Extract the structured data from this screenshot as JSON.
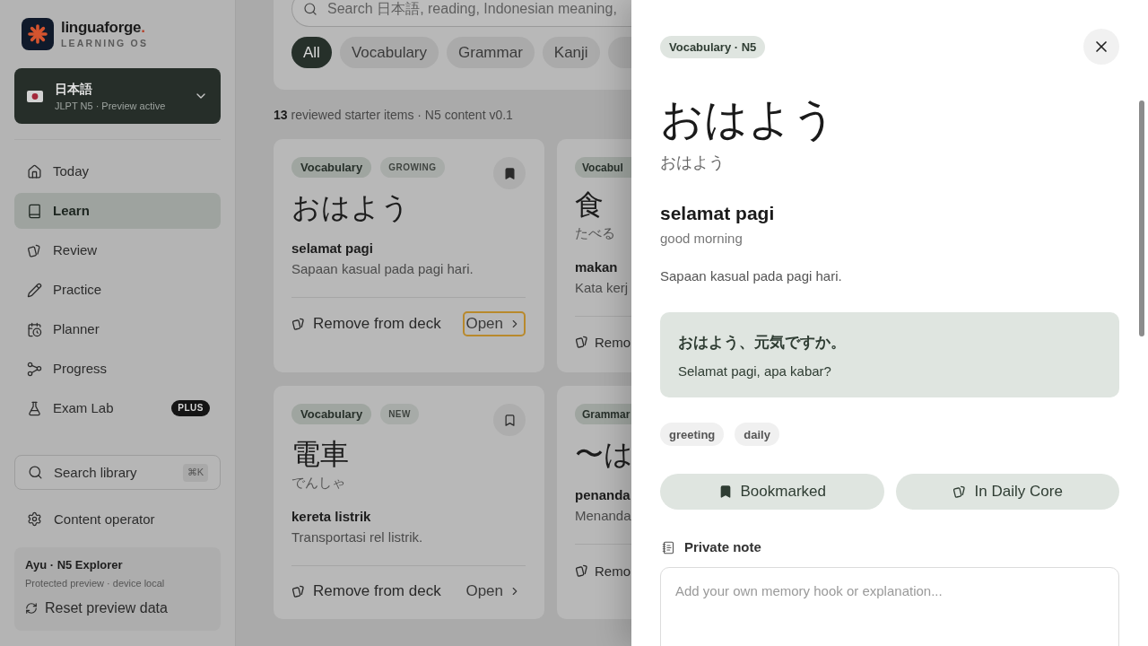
{
  "sidebar": {
    "brand": {
      "name": "linguaforge.",
      "tagline": "LEARNING OS"
    },
    "language": {
      "name": "日本語",
      "detail": "JLPT N5 · Preview active"
    },
    "nav": [
      {
        "label": "Today",
        "selected": false
      },
      {
        "label": "Learn",
        "selected": true
      },
      {
        "label": "Review",
        "selected": false
      },
      {
        "label": "Practice",
        "selected": false
      },
      {
        "label": "Planner",
        "selected": false
      },
      {
        "label": "Progress",
        "selected": false
      },
      {
        "label": "Exam Lab",
        "selected": false,
        "badge": "PLUS"
      }
    ],
    "search": {
      "label": "Search library",
      "shortcut": "⌘K"
    },
    "operator": {
      "label": "Content operator"
    },
    "profile": {
      "name": "Ayu · N5 Explorer",
      "detail": "Protected preview · device local",
      "action": "Reset preview data"
    }
  },
  "library": {
    "search": {
      "placeholder": "Search 日本語, reading, Indonesian meaning,"
    },
    "filters": [
      {
        "label": "All",
        "selected": true
      },
      {
        "label": "Vocabulary",
        "selected": false
      },
      {
        "label": "Grammar",
        "selected": false
      },
      {
        "label": "Kanji",
        "selected": false
      },
      {
        "selected": false
      }
    ],
    "summary": "**13** reviewed starter items · N5 content v0.1",
    "cards": [
      {
        "type": "Vocabulary",
        "status": "GROWING",
        "bookmarked": true,
        "word": "おはよう",
        "meaning": "selamat pagi",
        "note": "Sapaan kasual pada pagi hari.",
        "action": "Remove from deck",
        "open": "Open",
        "focused": true
      },
      {
        "type": "Vocabul",
        "word": "食",
        "reading": "たべる",
        "meaning": "makan",
        "note": "Kata kerj",
        "action": "Remo"
      },
      {
        "type": "Vocabulary",
        "status": "NEW",
        "bookmarked": false,
        "word": "電車",
        "reading": "でんしゃ",
        "meaning": "kereta listrik",
        "note": "Transportasi rel listrik.",
        "action": "Remove from deck",
        "open": "Open",
        "focused": false
      },
      {
        "type": "Grammar",
        "word": "〜は",
        "meaning": "penanda",
        "note": "Menanda",
        "action": "Remo"
      }
    ]
  },
  "drawer": {
    "badge": "Vocabulary · N5",
    "word": "おはよう",
    "reading": "おはよう",
    "meaning": "selamat pagi",
    "gloss": "good morning",
    "note": "Sapaan kasual pada pagi hari.",
    "example": {
      "sentence": "おはよう、元気ですか。",
      "translation": "Selamat pagi, apa kabar?"
    },
    "tags": [
      "greeting",
      "daily"
    ],
    "actions": [
      {
        "label": "Bookmarked",
        "on": true
      },
      {
        "label": "In Daily Core",
        "on": true
      }
    ],
    "private_note": {
      "label": "Private note",
      "placeholder": "Add your own memory hook or explanation..."
    }
  }
}
